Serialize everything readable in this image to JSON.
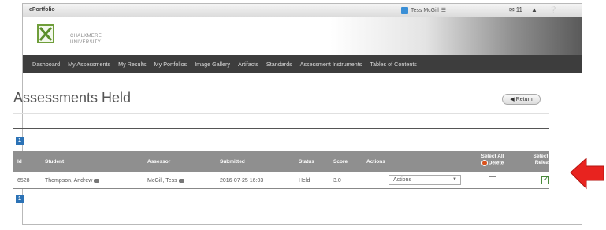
{
  "topbar": {
    "brand": "ePortfolio",
    "user_name": "Tess McGill",
    "mail_count": "11",
    "help_icon": "help-icon"
  },
  "banner": {
    "logo_line1": "CHALKMERE",
    "logo_line2": "UNIVERSITY"
  },
  "nav": {
    "items": [
      {
        "label": "Dashboard"
      },
      {
        "label": "My Assessments"
      },
      {
        "label": "My Results"
      },
      {
        "label": "My Portfolios"
      },
      {
        "label": "Image Gallery"
      },
      {
        "label": "Artifacts"
      },
      {
        "label": "Standards"
      },
      {
        "label": "Assessment Instruments"
      },
      {
        "label": "Tables of Contents"
      }
    ]
  },
  "main": {
    "title": "Assessments Held",
    "return_label": "Return",
    "pager_top": "1",
    "pager_bottom": "1"
  },
  "table": {
    "columns": {
      "id": "Id",
      "student": "Student",
      "assessor": "Assessor",
      "submitted": "Submitted",
      "status": "Status",
      "score": "Score",
      "actions": "Actions",
      "select_all_delete_line1": "Select All",
      "select_all_delete_line2": "Delete",
      "select_all_release_line1": "Select All",
      "select_all_release_line2": "Release"
    },
    "rows": [
      {
        "id": "6528",
        "student": "Thompson, Andrew",
        "assessor": "McGill, Tess",
        "submitted": "2016-07-25 16:03",
        "status": "Held",
        "score": "3.0",
        "action": "Actions",
        "delete_checked": false,
        "release_checked": true
      }
    ]
  },
  "colors": {
    "nav_bg": "#3d3d3d",
    "table_header_bg": "#8f8f8f",
    "pager_blue": "#2b72b6",
    "annotation_arrow": "#e8231f"
  }
}
